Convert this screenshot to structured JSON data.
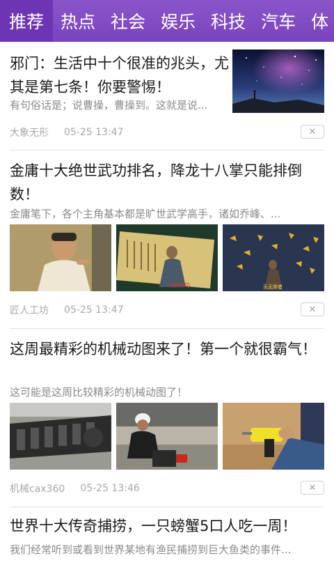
{
  "tabs": [
    {
      "label": "推荐"
    },
    {
      "label": "热点"
    },
    {
      "label": "社会"
    },
    {
      "label": "娱乐"
    },
    {
      "label": "科技"
    },
    {
      "label": "汽车"
    },
    {
      "label": "体"
    }
  ],
  "articles": [
    {
      "title": "邪门：生活中十个很准的兆头，尤其是第七条！你要警惕！",
      "summary": "有句俗话是；说曹操，曹操到。这就是说...",
      "source": "大象无形",
      "time": "05-25 13:47",
      "close": "✕"
    },
    {
      "title": "金庸十大绝世武功排名，降龙十八掌只能排倒数！",
      "summary": "金庸笔下，各个主角基本都是旷世武学高手，诸如乔峰、...",
      "source": "匠人工坊",
      "time": "05-25 13:47",
      "close": "✕",
      "images": [
        {
          "caption": ""
        },
        {
          "caption": "九阴神功"
        },
        {
          "caption": "乐无常者"
        }
      ]
    },
    {
      "title": "这周最精彩的机械动图来了！第一个就很霸气！",
      "summary": "这可能是这周比较精彩的机械动图了！",
      "source": "机械cax360",
      "time": "05-25 13:46",
      "close": "✕"
    },
    {
      "title": "世界十大传奇捕捞，一只螃蟹5口人吃一周！",
      "summary": "我们经常听到或看到世界某地有渔民捕捞到巨大鱼类的事件..."
    }
  ]
}
